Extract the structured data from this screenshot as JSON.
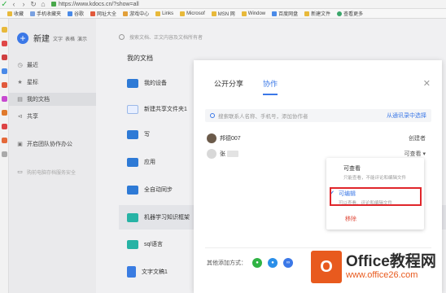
{
  "browser": {
    "url": "https://www.kdocs.cn/?show=all",
    "bookmarks": [
      "收藏",
      "手机收藏夹",
      "谷歌",
      "网址大全",
      "游戏中心",
      "Links",
      "Microsof",
      "MSN 网",
      "Window",
      "百度网盘",
      "新建文件",
      "查看更多"
    ]
  },
  "sidebar": {
    "new_label": "新建",
    "new_sub": [
      "文字",
      "表格",
      "演示"
    ],
    "items": [
      {
        "label": "最近",
        "icon": "clock-icon"
      },
      {
        "label": "星标",
        "icon": "star-icon"
      },
      {
        "label": "我的文档",
        "icon": "doc-icon"
      },
      {
        "label": "共享",
        "icon": "share-icon"
      },
      {
        "label": "开启团队协作办公",
        "icon": "team-icon"
      },
      {
        "label": "购前电脑存档服务安全",
        "icon": "disk-icon"
      }
    ]
  },
  "main": {
    "search_placeholder": "搜索文档、正文内容及文档所有者",
    "heading": "我的文档",
    "rows": [
      {
        "name": "我的设备",
        "type": "folder"
      },
      {
        "name": "新建共享文件夹1",
        "type": "shared"
      },
      {
        "name": "写",
        "type": "folder"
      },
      {
        "name": "应用",
        "type": "folder"
      },
      {
        "name": "全自动同步",
        "type": "folder"
      },
      {
        "name": "机器学习知识框架",
        "type": "mindmap"
      },
      {
        "name": "sql语言",
        "type": "mindmap"
      },
      {
        "name": "文字文稿1",
        "type": "doc"
      }
    ]
  },
  "modal": {
    "tab_public": "公开分享",
    "tab_collab": "协作",
    "search_placeholder": "搜索联系人名称、手机号，添加协作者",
    "contacts_link": "从通讯录中选择",
    "members": [
      {
        "name": "邦德007",
        "role": "创建者"
      },
      {
        "name": "张",
        "role": "可查看 ▾"
      }
    ],
    "footer_label": "其他添加方式："
  },
  "dropdown": {
    "view_title": "可查看",
    "view_desc": "只能查看，不能评论和编辑文件",
    "edit_title": "可编辑",
    "edit_desc": "可以查看、评论和编辑文件",
    "remove": "移除"
  },
  "watermark": {
    "title": "Office教程网",
    "url": "www.office26.com"
  },
  "colors": {
    "accent": "#3b78e7",
    "highlight": "#e0262b",
    "watermark": "#e85a1e"
  }
}
